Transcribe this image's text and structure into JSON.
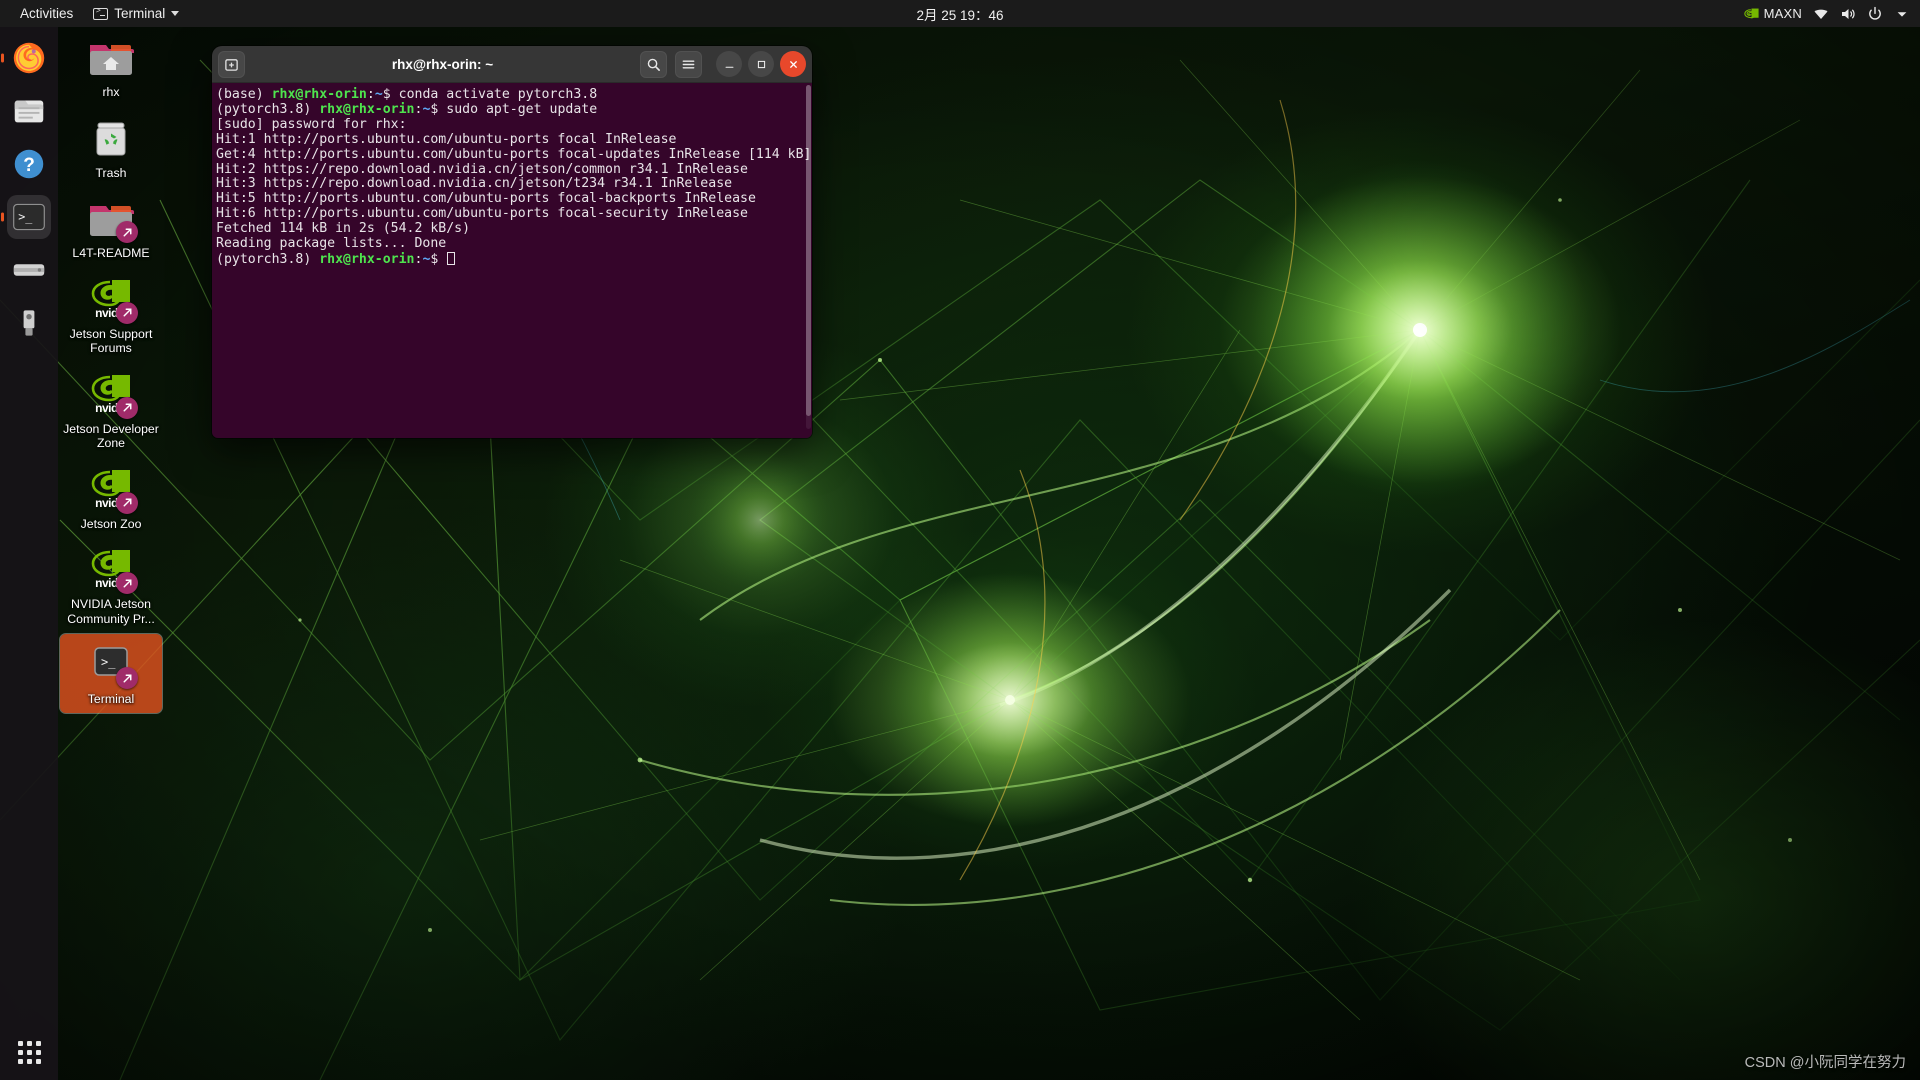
{
  "topbar": {
    "activities": "Activities",
    "app_menu": "Terminal",
    "app_menu_icon": "terminal-icon",
    "caret_icon": "chevron-down-icon",
    "clock": "2月 25  19：46",
    "power_mode": "MAXN",
    "nvidia_logo_icon": "nvidia-logo-icon",
    "wifi_icon": "wifi-icon",
    "volume_icon": "volume-icon",
    "power_icon": "power-icon",
    "menu_caret_icon": "chevron-down-icon"
  },
  "dock": {
    "items": [
      {
        "name": "firefox",
        "label": "Firefox Web Browser",
        "icon": "firefox-icon",
        "running": true,
        "active": false
      },
      {
        "name": "files",
        "label": "Files",
        "icon": "files-icon",
        "running": false,
        "active": false
      },
      {
        "name": "help",
        "label": "Help",
        "icon": "help-icon",
        "running": false,
        "active": false
      },
      {
        "name": "terminal",
        "label": "Terminal",
        "icon": "terminal-icon",
        "running": true,
        "active": true
      },
      {
        "name": "disks",
        "label": "Disk Usage Analyzer",
        "icon": "disk-icon",
        "running": false,
        "active": false
      },
      {
        "name": "usb-creator",
        "label": "Startup Disk Creator",
        "icon": "usb-icon",
        "running": false,
        "active": false
      }
    ],
    "show_apps_label": "Show Applications",
    "show_apps_icon": "grid-icon"
  },
  "desktop_icons": [
    {
      "label": "rhx",
      "icon": "home-folder-icon",
      "link": false,
      "selected": false
    },
    {
      "label": "Trash",
      "icon": "trash-icon",
      "link": false,
      "selected": false
    },
    {
      "label": "L4T-README",
      "icon": "folder-link-icon",
      "link": true,
      "selected": false
    },
    {
      "label": "Jetson Support Forums",
      "icon": "nvidia-link-icon",
      "link": true,
      "selected": false
    },
    {
      "label": "Jetson Developer Zone",
      "icon": "nvidia-link-icon",
      "link": true,
      "selected": false
    },
    {
      "label": "Jetson Zoo",
      "icon": "nvidia-link-icon",
      "link": true,
      "selected": false
    },
    {
      "label": "NVIDIA Jetson Community Pr...",
      "icon": "nvidia-link-icon",
      "link": true,
      "selected": false
    },
    {
      "label": "Terminal",
      "icon": "terminal-launcher-icon",
      "link": true,
      "selected": true
    }
  ],
  "terminal": {
    "title": "rhx@rhx-orin: ~",
    "new_tab_icon": "new-tab-icon",
    "search_icon": "search-icon",
    "menu_icon": "hamburger-menu-icon",
    "minimize_icon": "minimize-icon",
    "maximize_icon": "maximize-icon",
    "close_icon": "close-icon",
    "bg_color": "#35052a",
    "prompt_user_color": "#4ee44e",
    "prompt_path_color": "#5fa8f5",
    "lines": [
      {
        "parts": [
          {
            "t": "(base) ",
            "c": "white"
          },
          {
            "t": "rhx@rhx-orin",
            "c": "green"
          },
          {
            "t": ":",
            "c": "white"
          },
          {
            "t": "~",
            "c": "blue"
          },
          {
            "t": "$ conda activate pytorch3.8",
            "c": "white"
          }
        ]
      },
      {
        "parts": [
          {
            "t": "(pytorch3.8) ",
            "c": "white"
          },
          {
            "t": "rhx@rhx-orin",
            "c": "green"
          },
          {
            "t": ":",
            "c": "white"
          },
          {
            "t": "~",
            "c": "blue"
          },
          {
            "t": "$ sudo apt-get update",
            "c": "white"
          }
        ]
      },
      {
        "parts": [
          {
            "t": "[sudo] password for rhx:",
            "c": "white"
          }
        ]
      },
      {
        "parts": [
          {
            "t": "Hit:1 http://ports.ubuntu.com/ubuntu-ports focal InRelease",
            "c": "white"
          }
        ]
      },
      {
        "parts": [
          {
            "t": "Get:4 http://ports.ubuntu.com/ubuntu-ports focal-updates InRelease [114 kB]",
            "c": "white"
          }
        ]
      },
      {
        "parts": [
          {
            "t": "Hit:2 https://repo.download.nvidia.cn/jetson/common r34.1 InRelease",
            "c": "white"
          }
        ]
      },
      {
        "parts": [
          {
            "t": "Hit:3 https://repo.download.nvidia.cn/jetson/t234 r34.1 InRelease",
            "c": "white"
          }
        ]
      },
      {
        "parts": [
          {
            "t": "Hit:5 http://ports.ubuntu.com/ubuntu-ports focal-backports InRelease",
            "c": "white"
          }
        ]
      },
      {
        "parts": [
          {
            "t": "Hit:6 http://ports.ubuntu.com/ubuntu-ports focal-security InRelease",
            "c": "white"
          }
        ]
      },
      {
        "parts": [
          {
            "t": "Fetched 114 kB in 2s (54.2 kB/s)",
            "c": "white"
          }
        ]
      },
      {
        "parts": [
          {
            "t": "Reading package lists... Done",
            "c": "white"
          }
        ]
      },
      {
        "parts": [
          {
            "t": "(pytorch3.8) ",
            "c": "white"
          },
          {
            "t": "rhx@rhx-orin",
            "c": "green"
          },
          {
            "t": ":",
            "c": "white"
          },
          {
            "t": "~",
            "c": "blue"
          },
          {
            "t": "$ ",
            "c": "white"
          },
          {
            "t": "",
            "c": "cursor"
          }
        ]
      }
    ]
  },
  "watermark": "CSDN @小阮同学在努力"
}
